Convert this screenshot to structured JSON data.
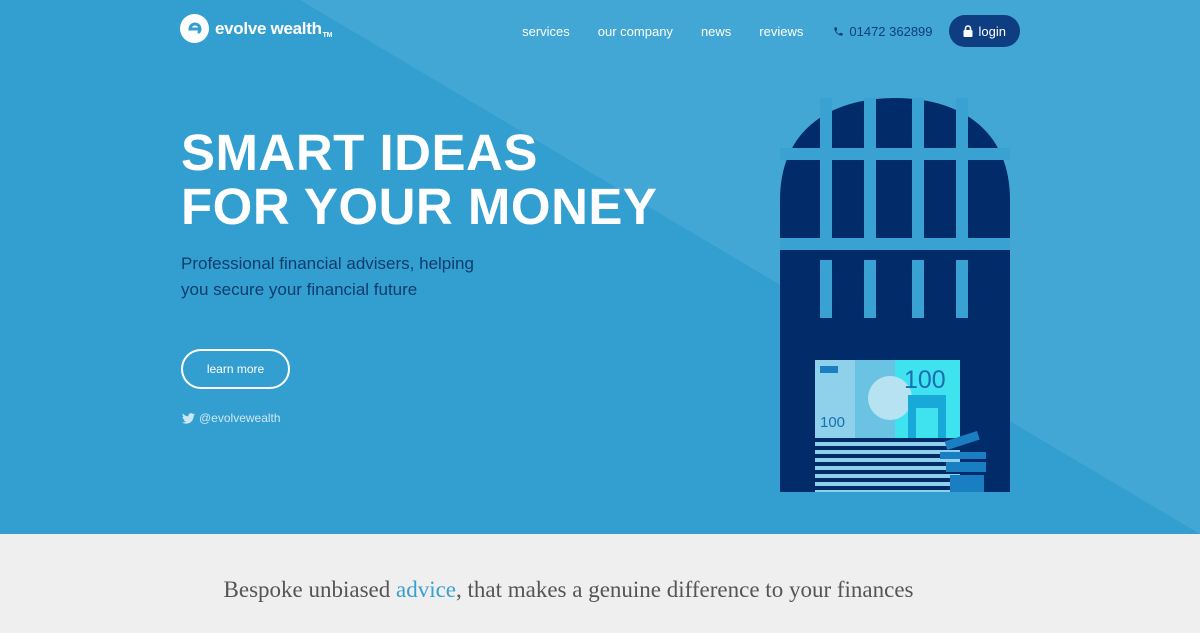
{
  "brand": {
    "name": "evolve wealth",
    "tm": "TM"
  },
  "nav": {
    "items": [
      "services",
      "our company",
      "news",
      "reviews"
    ],
    "phone": "01472 362899",
    "login_label": "login"
  },
  "hero": {
    "headline_line1": "SMART IDEAS",
    "headline_line2": "FOR YOUR MONEY",
    "subtext": "Professional financial advisers, helping you secure your financial future",
    "cta_label": "learn more",
    "twitter_handle": "@evolvewealth",
    "note_value_large": "100",
    "note_value_small": "100"
  },
  "tagline": {
    "before": "Bespoke unbiased ",
    "accent": "advice",
    "after": ", that makes a genuine difference to your finances"
  },
  "colors": {
    "hero_bg": "#339fd0",
    "hero_light": "#45a8d4",
    "navy": "#0e3d82",
    "dark_window": "#022b6a",
    "accent_text": "#3a9fcf",
    "footer_bg": "#efefef"
  }
}
